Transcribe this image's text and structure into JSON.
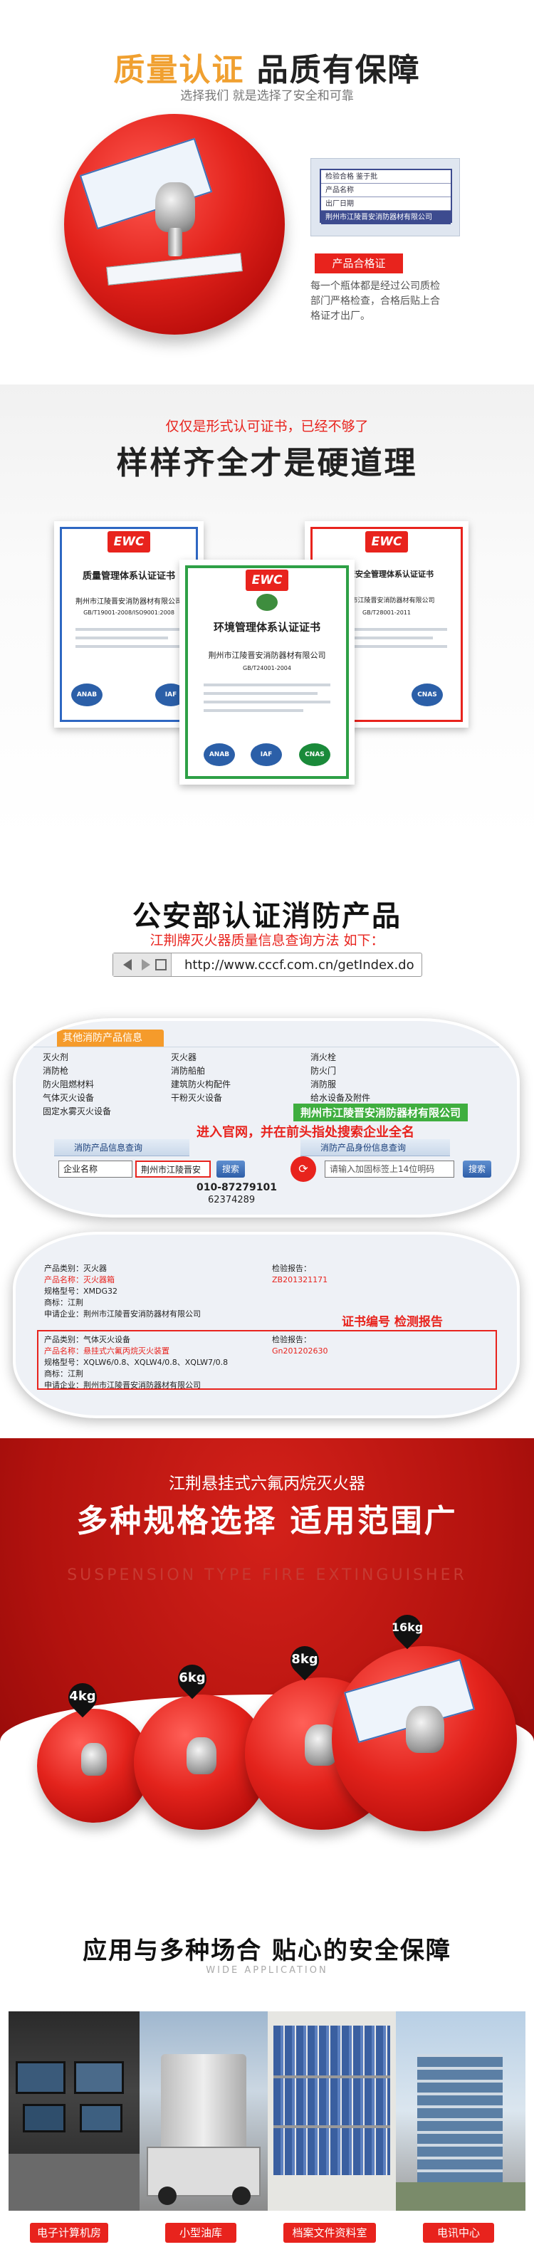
{
  "section1": {
    "title_a": "质量认证",
    "title_b": "品质有保障",
    "subtitle": "选择我们 就是选择了安全和可靠",
    "cert_card_rows": [
      "检验合格 鉴于批",
      "产品名称",
      "出厂日期",
      "荆州市江陵晋安消防器材有限公司"
    ],
    "tag": "产品合格证",
    "desc": "每一个瓶体都是经过公司质检部门严格检查，合格后贴上合格证才出厂。"
  },
  "section2": {
    "subtitle": "仅仅是形式认可证书，已经不够了",
    "title": "样样齐全才是硬道理",
    "certificates": [
      {
        "logo": "EWC",
        "title": "质量管理体系认证证书",
        "holder": "荆州市江陵晋安消防器材有限公司",
        "std": "GB/T19001-2008/ISO9001:2008"
      },
      {
        "logo": "EWC",
        "title": "环境管理体系认证证书",
        "holder": "荆州市江陵晋安消防器材有限公司",
        "std": "GB/T24001-2004"
      },
      {
        "logo": "EWC",
        "title": "健康安全管理体系认证证书",
        "holder": "荆州市江陵晋安消防器材有限公司",
        "std": "GB/T28001-2011"
      }
    ],
    "seals": [
      "ANAB",
      "IAF",
      "CNAS"
    ]
  },
  "section3": {
    "title": "公安部认证消防产品",
    "subtitle": "江荆牌灭火器质量信息查询方法 如下：",
    "url": "http://www.cccf.com.cn/getIndex.do",
    "menu_head": "其他消防产品信息",
    "menu_cols": [
      [
        "灭火剂",
        "消防枪",
        "防火阻燃材料",
        "气体灭火设备",
        "固定水雾灭火设备"
      ],
      [
        "灭火器",
        "消防船舶",
        "建筑防火构配件",
        "干粉灭火设备",
        ""
      ],
      [
        "消火栓",
        "防火门",
        "消防服",
        "给水设备及附件",
        ""
      ]
    ],
    "callout_company": "荆州市江陵晋安消防器材有限公司",
    "note1": "进入官网，并在前头指处搜索企业全名",
    "query_title": "消防产品信息查询",
    "query_title2": "消防产品身份信息查询",
    "select_label": "企业名称",
    "search_value": "荆州市江陵晋安",
    "search_btn": "搜索",
    "search_btn2": "搜索",
    "id_placeholder": "请输入加固标签上14位明码",
    "phone": "010-87279101",
    "phone2": "62374289",
    "rec1": {
      "category": "产品类别：灭火器",
      "name": "产品名称：灭火器箱",
      "model": "规格型号：XMDG32",
      "mark": "商标：江荆",
      "company": "申请企业：荆州市江陵晋安消防器材有限公司",
      "report_label": "检验报告：",
      "report_no": "ZB201321171"
    },
    "note2": "证书编号 检测报告",
    "rec2": {
      "category": "产品类别：气体灭火设备",
      "name": "产品名称：悬挂式六氟丙烷灭火装置",
      "model": "规格型号：XQLW6/0.8、XQLW4/0.8、XQLW7/0.8",
      "mark": "商标：江荆",
      "company": "申请企业：荆州市江陵晋安消防器材有限公司",
      "report_label": "检验报告：",
      "report_no": "Gn201202630"
    }
  },
  "section4": {
    "subtitle": "江荆悬挂式六氟丙烷灭火器",
    "title": "多种规格选择 适用范围广",
    "en": "SUSPENSION TYPE FIRE EXTINGUISHER",
    "sizes": [
      "4kg",
      "6kg",
      "8kg",
      "16kg"
    ]
  },
  "section5": {
    "title": "应用与多种场合 贴心的安全保障",
    "en": "WIDE APPLICATION",
    "captions": [
      "电子计算机房",
      "小型油库",
      "档案文件资料室",
      "电讯中心"
    ]
  },
  "colors": {
    "brand_red": "#e8231d",
    "accent_orange": "#f0a030",
    "callout_green": "#3fae3f"
  }
}
